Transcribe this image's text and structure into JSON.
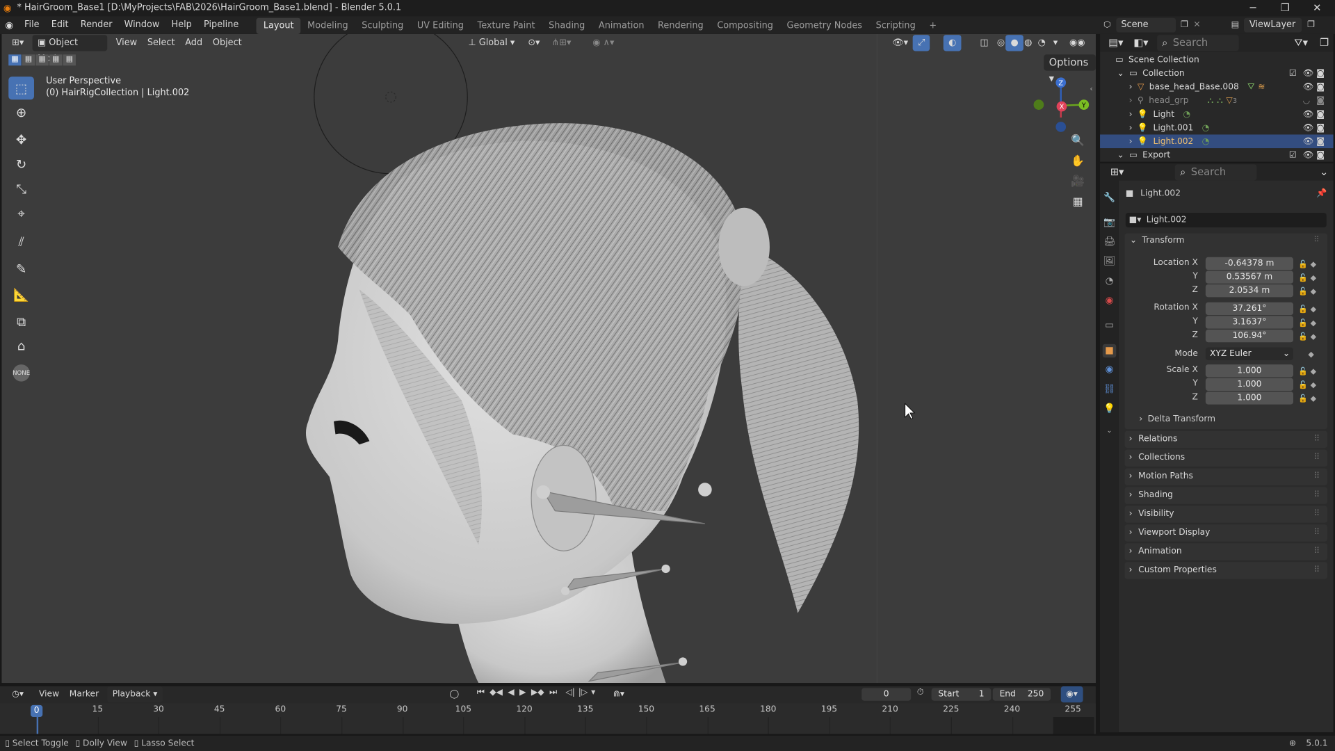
{
  "window": {
    "title": "* HairGroom_Base1 [D:\\MyProjects\\FAB\\2026\\HairGroom_Base1.blend] - Blender 5.0.1"
  },
  "menu": {
    "items": [
      "File",
      "Edit",
      "Render",
      "Window",
      "Help",
      "Pipeline"
    ]
  },
  "workspaces": [
    "Layout",
    "Modeling",
    "Sculpting",
    "UV Editing",
    "Texture Paint",
    "Shading",
    "Animation",
    "Rendering",
    "Compositing",
    "Geometry Nodes",
    "Scripting"
  ],
  "workspace_add": "+",
  "scene": {
    "label": "Scene",
    "view_layer": "ViewLayer"
  },
  "viewport": {
    "mode": "Object Mode",
    "menus": [
      "View",
      "Select",
      "Add",
      "Object"
    ],
    "orientation": "Global",
    "options": "Options",
    "perspective": "User Perspective",
    "collection_info": "(0) HairRigCollection | Light.002",
    "gizmo": {
      "z": "Z",
      "y": "Y",
      "x": "X"
    }
  },
  "outliner": {
    "search_placeholder": "Search",
    "scene_collection": "Scene Collection",
    "rows": [
      {
        "name": "Collection"
      },
      {
        "name": "base_head_Base.008"
      },
      {
        "name": "head_grp",
        "badge": "3"
      },
      {
        "name": "Light"
      },
      {
        "name": "Light.001"
      },
      {
        "name": "Light.002"
      },
      {
        "name": "Export"
      }
    ]
  },
  "properties": {
    "search_placeholder": "Search",
    "object_name": "Light.002",
    "datablock": "Light.002",
    "transform": {
      "title": "Transform",
      "location_label": "Location X",
      "location": [
        "-0.64378 m",
        "0.53567 m",
        "2.0534 m"
      ],
      "rotation_label": "Rotation X",
      "rotation": [
        "37.261°",
        "3.1637°",
        "106.94°"
      ],
      "mode_label": "Mode",
      "mode": "XYZ Euler",
      "scale_label": "Scale X",
      "scale": [
        "1.000",
        "1.000",
        "1.000"
      ],
      "y": "Y",
      "z": "Z",
      "delta": "Delta Transform"
    },
    "panels": [
      "Relations",
      "Collections",
      "Motion Paths",
      "Shading",
      "Visibility",
      "Viewport Display",
      "Animation",
      "Custom Properties"
    ]
  },
  "timeline": {
    "menus": [
      "View",
      "Marker",
      "Playback"
    ],
    "current_frame": "0",
    "start_label": "Start",
    "start": "1",
    "end_label": "End",
    "end": "250",
    "ticks": [
      "0",
      "15",
      "30",
      "45",
      "60",
      "75",
      "90",
      "105",
      "120",
      "135",
      "150",
      "165",
      "180",
      "195",
      "210",
      "225",
      "240",
      "255"
    ]
  },
  "statusbar": {
    "items": [
      "Select Toggle",
      "Dolly View",
      "Lasso Select"
    ],
    "version": "5.0.1"
  },
  "colors": {
    "accent": "#4772b3",
    "selection": "#334d80",
    "viewport_bg": "#3c3c3c",
    "header_bg": "#232323"
  }
}
